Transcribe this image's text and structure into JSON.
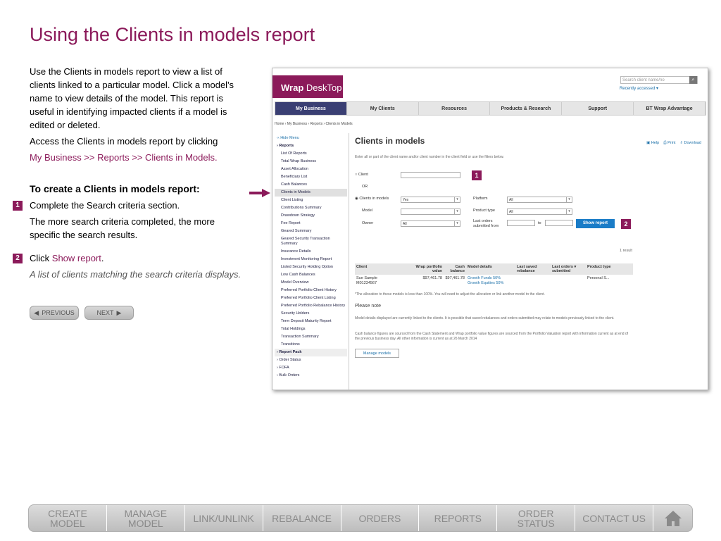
{
  "title": "Using the Clients in models report",
  "intro": "Use the Clients in models report to view a list of clients linked to a particular model. Click a model's name to view details of the model. This report is useful in identifying impacted clients if a model is edited or deleted.",
  "access_text": "Access the Clients in models report by clicking",
  "access_path": "My Business >> Reports >> Clients in Models.",
  "subheading": "To create a Clients in models report:",
  "steps": [
    {
      "num": "1",
      "text": "Complete the Search criteria section.",
      "detail": "The more search criteria completed, the more specific the search results."
    },
    {
      "num": "2",
      "text_prefix": "Click ",
      "link": "Show report",
      "text_suffix": ".",
      "detail": "A list of clients matching the search criteria displays."
    }
  ],
  "nav": {
    "previous": "PREVIOUS",
    "next": "NEXT"
  },
  "screenshot": {
    "logo_bold": "Wrap",
    "logo_rest": " DeskTop",
    "search_placeholder": "Search client name/no",
    "recently_accessed": "Recently accessed ▾",
    "main_nav": [
      "My Business",
      "My Clients",
      "Resources",
      "Products & Research",
      "Support",
      "BT Wrap Advantage"
    ],
    "breadcrumb": "Home  ›  My Business  ›  Reports  ›  Clients in Models",
    "side_menu": {
      "hide": "‹‹ Hide Menu",
      "reports": "› Reports",
      "items": [
        "List Of Reports",
        "Total Wrap Business",
        "Asset Allocation",
        "Beneficiary List",
        "Cash Balances",
        "Clients in Models",
        "Client Listing",
        "Contributions Summary",
        "Drawdown Strategy",
        "Fee Report",
        "Geared Summary",
        "Geared Security Transaction Summary",
        "Insurance Details",
        "Investment Monitoring Report",
        "Listed Security Holding Option",
        "Low Cash Balances",
        "Model Overview",
        "Preferred Portfolio Client History",
        "Preferred Portfolio Client Listing",
        "Preferred Portfolio Rebalance History",
        "Security Holders",
        "Term Deposit Maturity Report",
        "Total Holdings",
        "Transaction Summary",
        "Transitions"
      ],
      "report_pack": "› Report Pack",
      "others": [
        "› Order Status",
        "› FOFA",
        "› Bulk Orders"
      ]
    },
    "content_title": "Clients in models",
    "tools": {
      "help": "Help",
      "print": "Print",
      "download": "Download"
    },
    "intro": "Enter all or part of the client name and/or client number in the client field or use the filters below.",
    "form": {
      "client_label": "Client",
      "or_label": "OR",
      "clients_in_models_label": "Clients in models",
      "clients_in_models_value": "Yes",
      "platform_label": "Platform",
      "platform_value": "All",
      "model_label": "Model",
      "product_type_label": "Product type",
      "product_type_value": "All",
      "owner_label": "Owner",
      "owner_value": "All",
      "last_orders_label": "Last orders submitted from",
      "to_label": "to",
      "show_report": "Show report"
    },
    "badges": [
      "1",
      "2"
    ],
    "result_count": "1 result",
    "table": {
      "headers": [
        "Client",
        "Wrap portfolio value",
        "Cash balance",
        "Model details",
        "Last saved rebalance",
        "Last orders ▾ submitted",
        "Product type"
      ],
      "row": {
        "client": "Sue Sample",
        "client_no": "M01234567",
        "wrap_value": "$97,461.78",
        "cash": "$97,461.78",
        "model1": "Growth Funds 50%",
        "model2": "Growth Equities 50%",
        "product": "Personal S..."
      }
    },
    "allocation_note": "*The allocation to these models is less than 100%. You will need to adjust the allocation or link another model to the client.",
    "please_note": "Please note",
    "note1": "Model details displayed are currently linked to the clients. It is possible that saved rebalances and orders submitted may relate to models previously linked to the client.",
    "note2": "Cash balance figures are sourced from the Cash Statement and Wrap portfolio value figures are sourced from the Portfolio Valuation report with information current as at end of the previous business day. All other information is current as at 26 March 2014",
    "manage_models": "Manage models"
  },
  "bottom_nav": [
    "CREATE\nMODEL",
    "MANAGE\nMODEL",
    "LINK/UNLINK",
    "REBALANCE",
    "ORDERS",
    "REPORTS",
    "ORDER\nSTATUS",
    "CONTACT US"
  ],
  "colors": {
    "accent": "#8b1a5a",
    "link": "#1a6fa8",
    "nav_active": "#3a3f73",
    "button": "#1a7cc7"
  }
}
